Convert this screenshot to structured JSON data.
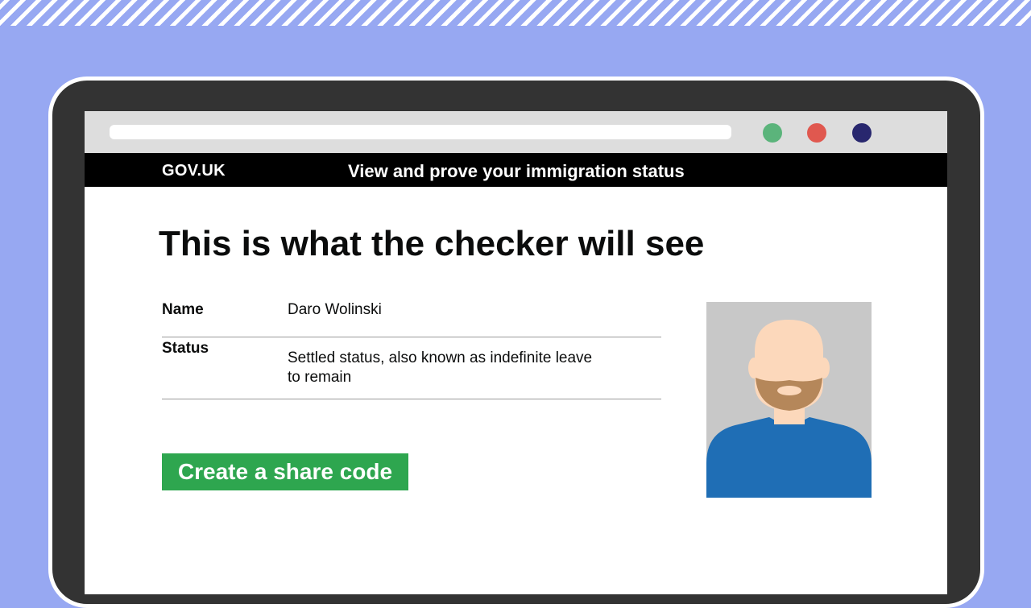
{
  "header": {
    "logo": "GOV.UK",
    "service_name": "View and prove your immigration status"
  },
  "main": {
    "title": "This is what the checker will see",
    "summary": [
      {
        "key": "Name",
        "value": "Daro Wolinski"
      },
      {
        "key": "Status",
        "value": "Settled status, also known as indefinite leave to remain"
      }
    ],
    "button_label": "Create a share code"
  },
  "browser": {
    "window_buttons": [
      {
        "name": "green",
        "color": "#5bb47b"
      },
      {
        "name": "red",
        "color": "#e0584f"
      },
      {
        "name": "navy",
        "color": "#28276e"
      }
    ]
  },
  "colors": {
    "background": "#97a8f2",
    "button": "#2ea64f",
    "header": "#000000",
    "photo_background": "#c8c8c8",
    "shirt": "#1f6eb5",
    "skin": "#fcd8bb",
    "beard": "#b5875a"
  },
  "icons": {
    "photo": "person-avatar-icon"
  }
}
